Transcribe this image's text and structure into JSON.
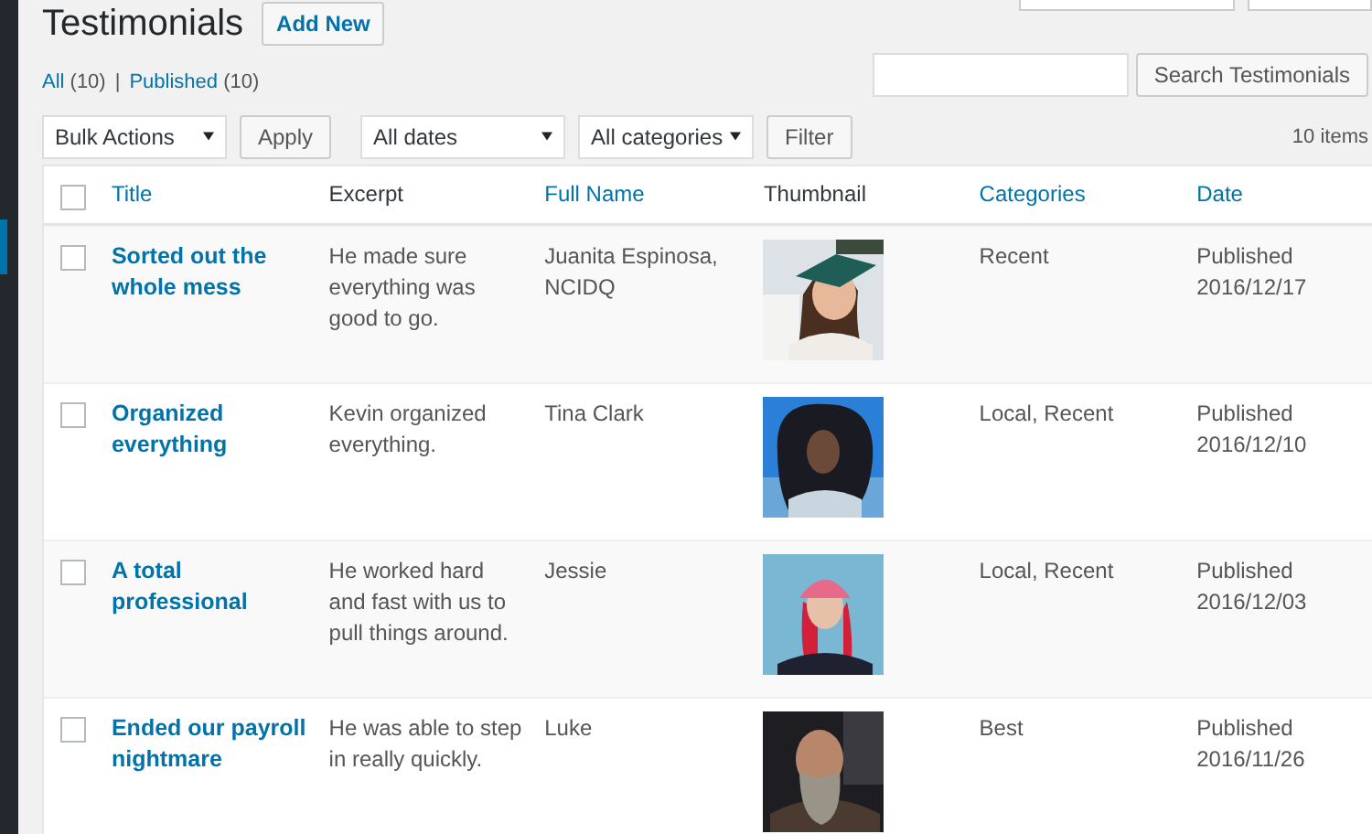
{
  "page_title": "Testimonials",
  "add_new": "Add New",
  "views": [
    {
      "label": "All",
      "count": "(10)"
    },
    {
      "label": "Published",
      "count": "(10)"
    }
  ],
  "view_separator": "|",
  "search": {
    "button": "Search Testimonials"
  },
  "bulk_action": {
    "select": "Bulk Actions",
    "button": "Apply"
  },
  "filters": {
    "selects": [
      "All dates",
      "All categories"
    ],
    "button": "Filter"
  },
  "item_count": "10 items",
  "table": {
    "select_all_checked": false,
    "columns": [
      {
        "label": "Title",
        "sortable": true
      },
      {
        "label": "Excerpt",
        "sortable": false
      },
      {
        "label": "Full Name",
        "sortable": true
      },
      {
        "label": "Thumbnail",
        "sortable": false
      },
      {
        "label": "Categories",
        "sortable": true
      },
      {
        "label": "Date",
        "sortable": true
      }
    ],
    "rows": [
      {
        "checked": false,
        "title": "Sorted out the whole mess",
        "excerpt": "He made sure everything was good to go.",
        "full_name": "Juanita Espinosa, NCIDQ",
        "categories": "Recent",
        "status": "Published",
        "date": "2016/12/17"
      },
      {
        "checked": false,
        "title": "Organized everything",
        "excerpt": "Kevin organized everything.",
        "full_name": "Tina Clark",
        "categories": "Local, Recent",
        "status": "Published",
        "date": "2016/12/10"
      },
      {
        "checked": false,
        "title": "A total professional",
        "excerpt": "He worked hard and fast with us to pull things around.",
        "full_name": "Jessie",
        "categories": "Local, Recent",
        "status": "Published",
        "date": "2016/12/03"
      },
      {
        "checked": false,
        "title": "Ended our payroll nightmare",
        "excerpt": "He was able to step in really quickly.",
        "full_name": "Luke",
        "categories": "Best",
        "status": "Published",
        "date": "2016/11/26"
      }
    ]
  }
}
